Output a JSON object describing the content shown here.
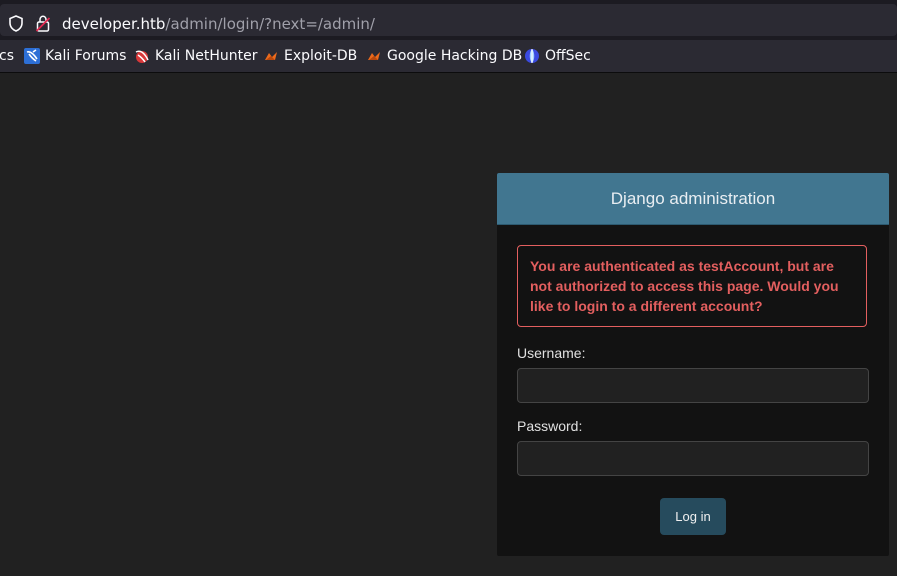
{
  "browser": {
    "url_host": "developer.htb",
    "url_path": "/admin/login/?next=/admin/",
    "bookmarks": [
      {
        "label": "cs",
        "icon": "kali-docs-icon"
      },
      {
        "label": "Kali Forums",
        "icon": "kali-forums-icon"
      },
      {
        "label": "Kali NetHunter",
        "icon": "kali-nethunter-icon"
      },
      {
        "label": "Exploit-DB",
        "icon": "exploit-db-icon"
      },
      {
        "label": "Google Hacking DB",
        "icon": "ghdb-icon"
      },
      {
        "label": "OffSec",
        "icon": "offsec-icon"
      }
    ]
  },
  "login": {
    "title": "Django administration",
    "error": "You are authenticated as testAccount, but are not authorized to access this page. Would you like to login to a different account?",
    "username_label": "Username:",
    "username_value": "",
    "password_label": "Password:",
    "password_value": "",
    "submit_label": "Log in"
  },
  "colors": {
    "header_bg": "#417690",
    "error": "#e35f5f",
    "button_bg": "#264b5d",
    "page_bg": "#212121",
    "box_bg": "#121212"
  }
}
